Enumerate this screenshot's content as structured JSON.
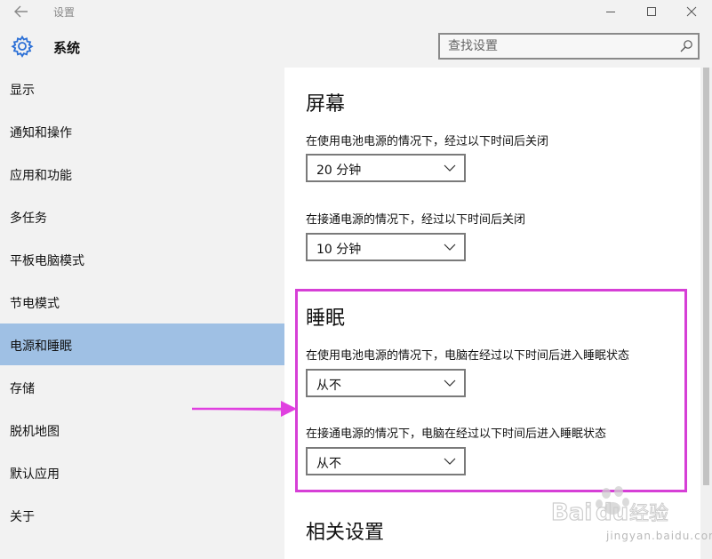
{
  "window": {
    "title": "设置",
    "back_icon": "arrow-left-icon",
    "controls": [
      "minimize-icon",
      "maximize-icon",
      "close-icon"
    ]
  },
  "header": {
    "icon": "gear-icon",
    "title": "系统",
    "search_placeholder": "查找设置"
  },
  "sidebar": {
    "items": [
      {
        "label": "显示"
      },
      {
        "label": "通知和操作"
      },
      {
        "label": "应用和功能"
      },
      {
        "label": "多任务"
      },
      {
        "label": "平板电脑模式"
      },
      {
        "label": "节电模式"
      },
      {
        "label": "电源和睡眠",
        "selected": true
      },
      {
        "label": "存储"
      },
      {
        "label": "脱机地图"
      },
      {
        "label": "默认应用"
      },
      {
        "label": "关于"
      }
    ]
  },
  "screen": {
    "title": "屏幕",
    "battery_label": "在使用电池电源的情况下，经过以下时间后关闭",
    "battery_value": "20 分钟",
    "plugged_label": "在接通电源的情况下，经过以下时间后关闭",
    "plugged_value": "10 分钟"
  },
  "sleep": {
    "title": "睡眠",
    "battery_label": "在使用电池电源的情况下，电脑在经过以下时间后进入睡眠状态",
    "battery_value": "从不",
    "plugged_label": "在接通电源的情况下，电脑在经过以下时间后进入睡眠状态",
    "plugged_value": "从不"
  },
  "related": {
    "title": "相关设置"
  },
  "annotation": {
    "highlight_color": "#d63fd6",
    "arrow_color": "#e040e0"
  },
  "watermark": {
    "text": "Baidu经验",
    "url_text": "jingyan.baidu.com"
  },
  "colors": {
    "sidebar_bg": "#f2f2f2",
    "selected_bg": "#9fc0e4"
  }
}
